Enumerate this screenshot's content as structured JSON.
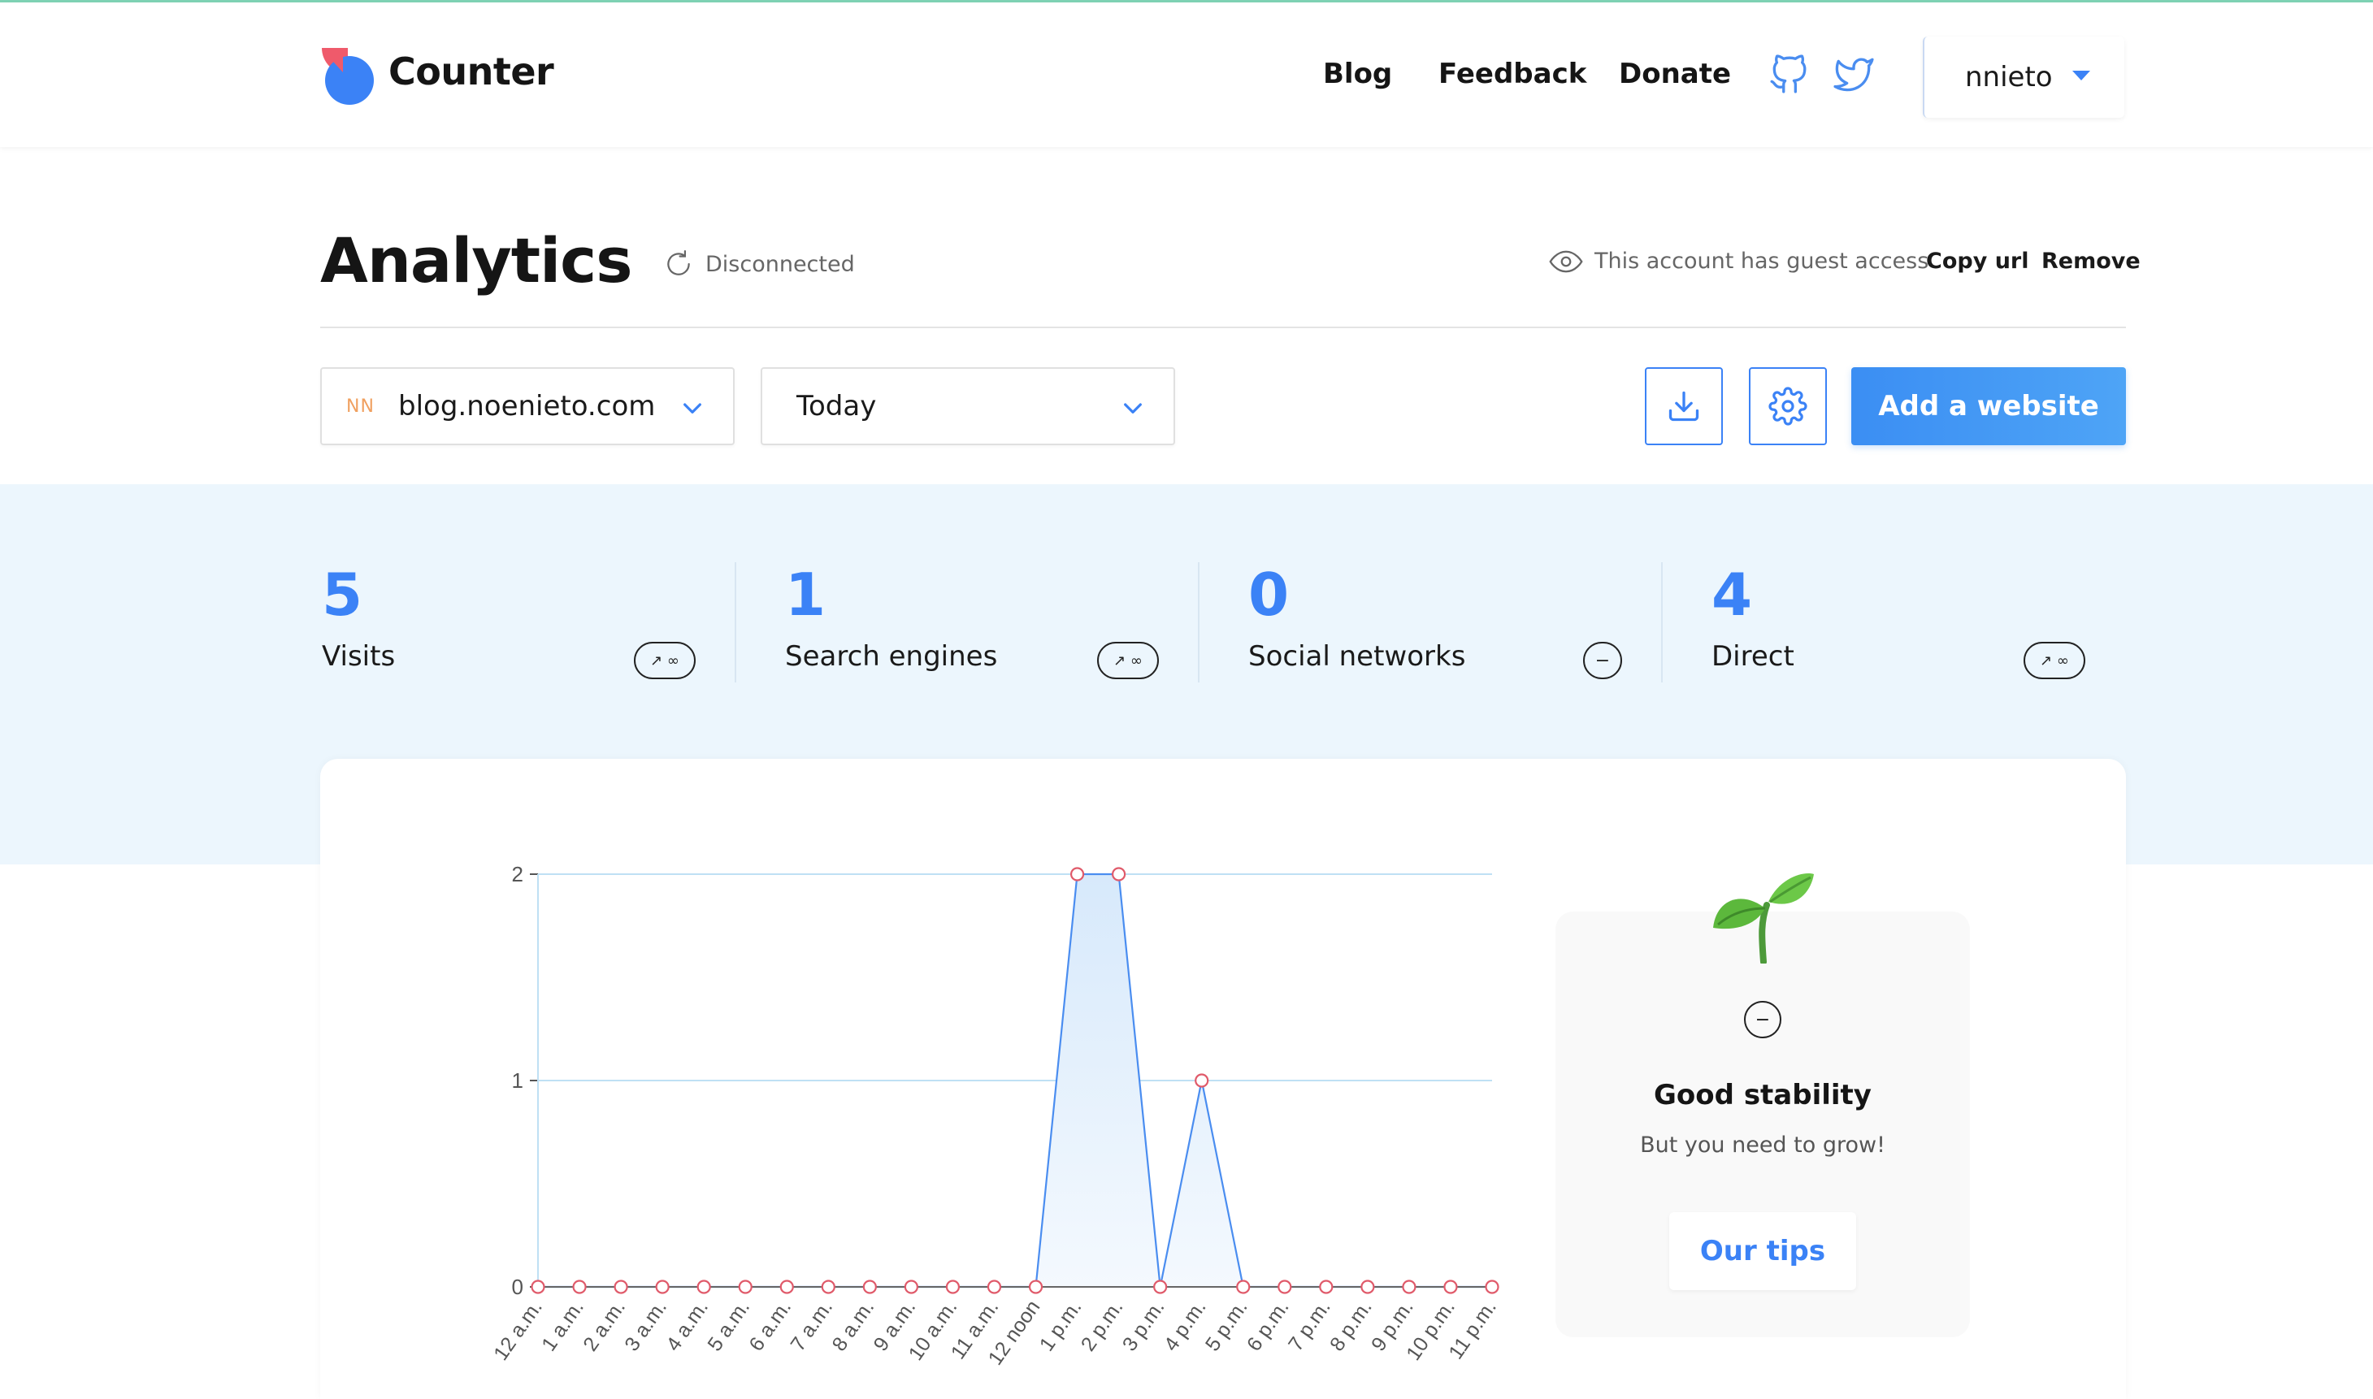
{
  "header": {
    "brand": "Counter",
    "nav": [
      "Blog",
      "Feedback",
      "Donate"
    ],
    "social_icons": [
      "github-icon",
      "twitter-icon"
    ],
    "user": "nnieto"
  },
  "title_row": {
    "title": "Analytics",
    "status": "Disconnected",
    "guest_text": "This account has guest access",
    "copy_url": "Copy url",
    "remove": "Remove"
  },
  "controls": {
    "site_initials": "NN",
    "site": "blog.noenieto.com",
    "range": "Today",
    "add_website": "Add a website"
  },
  "stats": [
    {
      "value": "5",
      "label": "Visits",
      "trend": "↗ ∞"
    },
    {
      "value": "1",
      "label": "Search engines",
      "trend": "↗ ∞"
    },
    {
      "value": "0",
      "label": "Social networks",
      "trend": "−"
    },
    {
      "value": "4",
      "label": "Direct",
      "trend": "↗ ∞"
    }
  ],
  "tips": {
    "icon_text": "−",
    "title": "Good stability",
    "subtitle": "But you need to grow!",
    "button": "Our tips"
  },
  "colors": {
    "accent": "#3b82f6",
    "point": "#e05a6a",
    "band": "#ecf6fd"
  },
  "chart_data": {
    "type": "area",
    "categories": [
      "12 a.m.",
      "1 a.m.",
      "2 a.m.",
      "3 a.m.",
      "4 a.m.",
      "5 a.m.",
      "6 a.m.",
      "7 a.m.",
      "8 a.m.",
      "9 a.m.",
      "10 a.m.",
      "11 a.m.",
      "12 noon",
      "1 p.m.",
      "2 p.m.",
      "3 p.m.",
      "4 p.m.",
      "5 p.m.",
      "6 p.m.",
      "7 p.m.",
      "8 p.m.",
      "9 p.m.",
      "10 p.m.",
      "11 p.m."
    ],
    "values": [
      0,
      0,
      0,
      0,
      0,
      0,
      0,
      0,
      0,
      0,
      0,
      0,
      0,
      2,
      2,
      0,
      1,
      0,
      0,
      0,
      0,
      0,
      0,
      0
    ],
    "yticks": [
      0,
      1,
      2
    ],
    "ylim": [
      0,
      2
    ],
    "grid": true
  }
}
